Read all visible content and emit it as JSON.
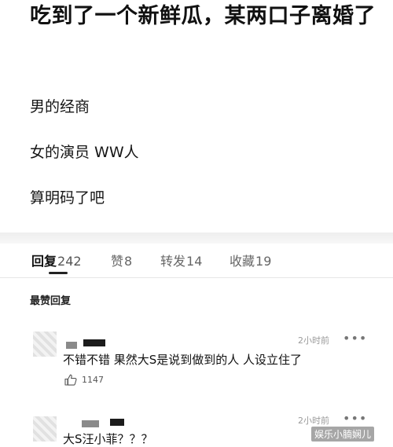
{
  "post": {
    "title": "吃到了一个新鲜瓜，某两口子离婚了",
    "lines": [
      "男的经商",
      "女的演员 WW人",
      "算明码了吧"
    ]
  },
  "tabs": [
    {
      "label": "回复",
      "count": "242",
      "active": true
    },
    {
      "label": "赞",
      "count": "8",
      "active": false
    },
    {
      "label": "转发",
      "count": "14",
      "active": false
    },
    {
      "label": "收藏",
      "count": "19",
      "active": false
    }
  ],
  "section_label": "最赞回复",
  "comments": [
    {
      "time": "2小时前",
      "text": "不错不错 果然大S是说到做到的人 人设立住了",
      "likes": "1147",
      "more": "•••"
    },
    {
      "time": "2小时前",
      "text": "大S汪小菲？？？",
      "more": "•••"
    }
  ],
  "watermark": "娱乐小腩娴儿",
  "colors": {
    "background": "#ffffff",
    "text": "#111111",
    "muted": "#9a9a9a",
    "band": "#eeeeee"
  }
}
